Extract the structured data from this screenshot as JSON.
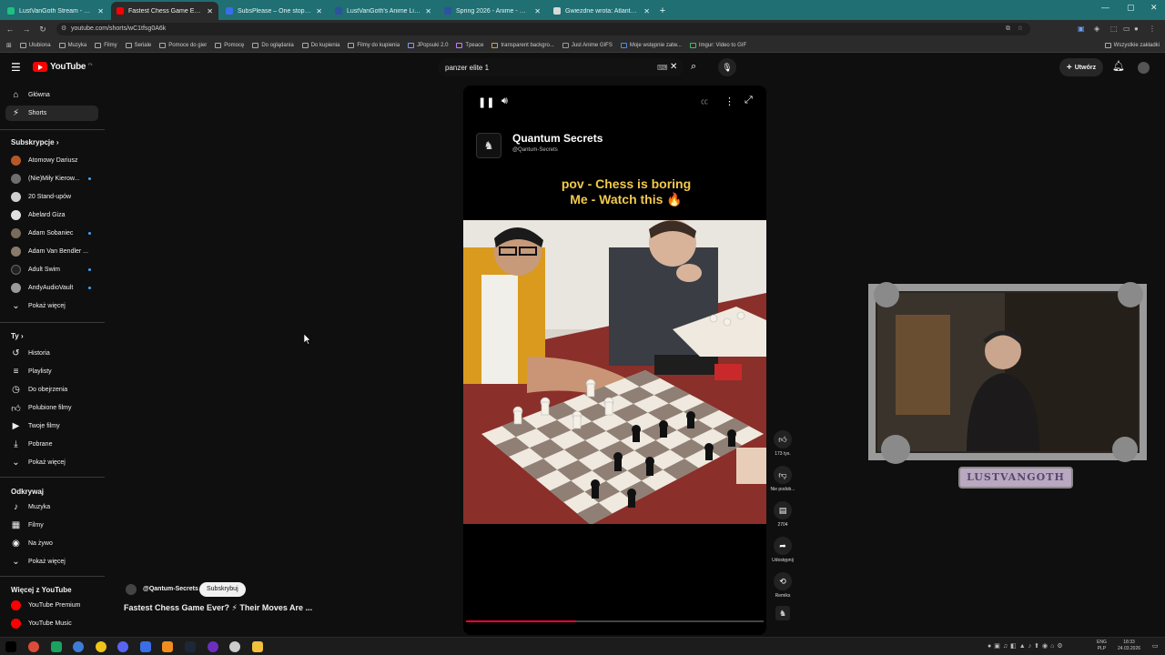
{
  "browser": {
    "tabs": [
      {
        "label": "LustVanGoth Stream - Watch Li",
        "color": "#19c37d"
      },
      {
        "label": "Fastest Chess Game Ever?",
        "color": "#ff0000"
      },
      {
        "label": "SubsPlease – One stop shop fo",
        "color": "#3a6ee8"
      },
      {
        "label": "LustVanGoth's Anime List - My",
        "color": "#2e51a2"
      },
      {
        "label": "Spring 2026 - Anime - MyAnim",
        "color": "#2e51a2"
      },
      {
        "label": "Gwiezdne wrota: Atlantyda / Sz",
        "color": "#d9d9d9"
      }
    ],
    "new_tab": "+",
    "window_controls": {
      "min": "—",
      "max": "▢",
      "close": "✕"
    },
    "url": "youtube.com/shorts/wC1tfsg0A6k",
    "bookmarks": [
      "Ulubiona",
      "Muzyka",
      "Filmy",
      "Seriale",
      "Pomoce do gier",
      "Pomocę",
      "Do oglądania",
      "Do kupienia",
      "Filmy do kupienia",
      "JPopsuki 2.0",
      "Tpeace",
      "transparent backgro...",
      "Just Anime GIFS",
      "Moje wstępnie zatw...",
      "Imgur: Video to GIF"
    ],
    "all_bookmarks": "Wszystkie zakładki"
  },
  "youtube": {
    "logo_text": "YouTube",
    "logo_region": "PL",
    "search_value": "panzer elite 1",
    "create_label": "Utwórz",
    "sidebar": {
      "top_items": [
        {
          "label": "Główna",
          "icon": "home-icon",
          "selected": false
        },
        {
          "label": "Shorts",
          "icon": "shorts-icon",
          "selected": true
        }
      ],
      "subscriptions_header": "Subskrypcje",
      "subscriptions": [
        {
          "label": "Atomowy Dariusz",
          "color": "#b4582a",
          "dot": false
        },
        {
          "label": "(Nie)Miły Kierow...",
          "color": "#6e6e6e",
          "dot": true
        },
        {
          "label": "20 Stand-upów",
          "color": "#d0d0d0",
          "dot": false
        },
        {
          "label": "Abelard Giza",
          "color": "#e0e0e0",
          "dot": false
        },
        {
          "label": "Adam Sobaniec",
          "color": "#7a6a5a",
          "dot": true
        },
        {
          "label": "Adam Van Bendler ...",
          "color": "#8a7a6a",
          "dot": false
        },
        {
          "label": "Adult Swim",
          "color": "#222222",
          "dot": true
        },
        {
          "label": "AndyAudioVault",
          "color": "#9a9a9a",
          "dot": true
        }
      ],
      "show_more": "Pokaż więcej",
      "you_header": "Ty",
      "you_items": [
        {
          "label": "Historia",
          "icon": "history-icon"
        },
        {
          "label": "Playlisty",
          "icon": "playlist-icon"
        },
        {
          "label": "Do obejrzenia",
          "icon": "watch-later-icon"
        },
        {
          "label": "Polubione filmy",
          "icon": "like-icon"
        },
        {
          "label": "Twoje filmy",
          "icon": "your-videos-icon"
        },
        {
          "label": "Pobrane",
          "icon": "download-icon"
        },
        {
          "label": "Pokaż więcej",
          "icon": "chevron-down-icon"
        }
      ],
      "explore_header": "Odkrywaj",
      "explore_items": [
        {
          "label": "Muzyka",
          "icon": "music-icon"
        },
        {
          "label": "Filmy",
          "icon": "film-icon"
        },
        {
          "label": "Na żywo",
          "icon": "live-icon"
        },
        {
          "label": "Pokaż więcej",
          "icon": "chevron-down-icon"
        }
      ],
      "more_header": "Więcej z YouTube",
      "more_items": [
        {
          "label": "YouTube Premium",
          "color": "#ff0000"
        },
        {
          "label": "YouTube Music",
          "color": "#ff0000"
        }
      ]
    },
    "short": {
      "channel_name": "Quantum Secrets",
      "channel_handle": "@Qantum-Secrets",
      "overlay_line1": "pov - Chess is boring",
      "overlay_line2": "Me - Watch this 🔥",
      "bottom_handle": "@Qantum-Secrets",
      "subscribe_label": "Subskrybuj",
      "title": "Fastest Chess Game Ever? ⚡ Their Moves Are ...",
      "progress": 0.37,
      "overlay_color": "#f2c94c"
    },
    "actions": {
      "likes": "173 tys.",
      "dislike": "Nie podob...",
      "comments": "2704",
      "share": "Udostępnij",
      "remix": "Remiks"
    }
  },
  "overlay": {
    "webcam_name": "LUSTVANGOTH"
  },
  "system": {
    "lang": "ENG",
    "layout": "PLP",
    "time": "18:33",
    "date": "24.03.2026"
  }
}
